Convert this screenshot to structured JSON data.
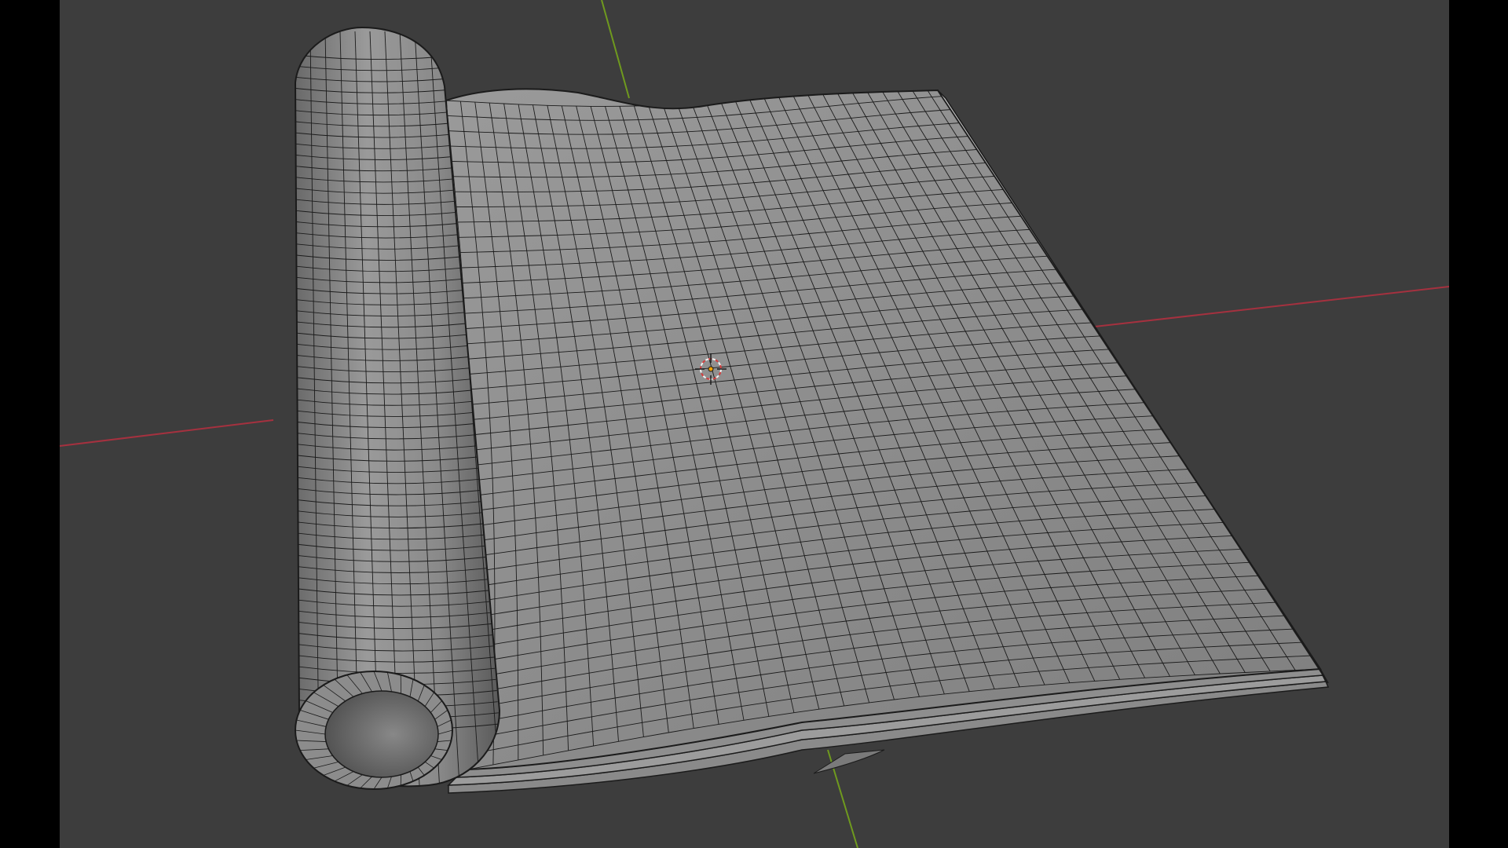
{
  "viewport": {
    "mode": "solid-wireframe-overlay",
    "background_color": "#3d3d3d",
    "letterbox_color": "#000000",
    "axes": {
      "x_axis_color": "#a5313f",
      "y_axis_color": "#6f9a1e"
    },
    "object": {
      "name": "curled-sheet-mesh",
      "face_color": "#8f8f8f",
      "wire_color": "#1b1b1b"
    },
    "origin_marker": {
      "name": "3d-cursor",
      "ring_colors": [
        "#d43c3c",
        "#f2f2f2"
      ],
      "dot_color": "#f0a000"
    }
  }
}
